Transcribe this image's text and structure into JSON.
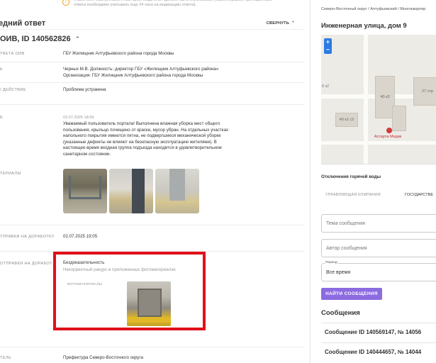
{
  "notice": {
    "icon": "warning-icon",
    "text": "Укажи конечный регламентный срок, когда ответ должен быть опубликован (таким образом, при подготовке ответа необходимо учитывать еще 24 часа на модерацию ответа)."
  },
  "section": {
    "title": "едний ответ",
    "collapse_label": "СВЕРНУТЬ"
  },
  "oiv": {
    "title": "ОИВ, ID 140562826"
  },
  "fields": [
    {
      "label": "ТВЕТА ОИВ",
      "value": "ГБУ Жилищник Алтуфьевского района города Москвы"
    },
    {
      "label": "Ь",
      "value": "Черных М.В. Должность: директор ГБУ «Жилищник Алтуфьевского района» Организация: ГБУ Жилищник Алтуфьевского района города Москвы"
    },
    {
      "label": "/ ДЕЙСТВИЕ",
      "value": "Проблема устранена"
    }
  ],
  "answer": {
    "label": "Б",
    "date": "02.07.2025 18:59",
    "text": "Уважаемый пользователь портала! Выполнена влажная уборка мест общего пользования, крыльцо почищено от краски, мусор убран. На отдельных участках напольного покрытия имеются пятна, не подвергшиеся механической уборке (указанные дефекты не влияют на безопасную эксплуатацию жителями). В настоящее время входная группа подъезда находится в удовлетворительном санитарном состоянии."
  },
  "materials_label": "ТЕРИАЛЫ",
  "rework_sent": {
    "label": "ТПРАВКИ НА ДОРАБОТКУ",
    "value": "02.07.2025 19:05"
  },
  "rework_reason": {
    "label": "ОТПРАВКИ НА ДОРАБОТ",
    "title": "Бездоказательность",
    "detail": "Некорректный ракурс в приложенных фотоматериалах",
    "photos_label": "ФОТОМАТЕРИАЛЫ"
  },
  "bottom_field": {
    "label": "ТЕЛЬ",
    "value": "Префектура Северо-Восточного округа"
  },
  "right": {
    "breadcrumb": "Северо-Восточный округ / Алтуфьевский / Многоквартир",
    "address": "Инженерная улица, дом 9",
    "map": {
      "zoom_in": "+",
      "zoom_out": "−",
      "labels": [
        "40 к3",
        "27 стр",
        "8 к2",
        "40 к1 с2"
      ],
      "poi": "Астарта Медик"
    },
    "topic": "Отключения горячей воды",
    "company_label": "УПРАВЛЯЮЩАЯ КОМПАНИЯ",
    "company_value": "ГОСУДАРСТВЕ",
    "topic_placeholder": "Тема сообщения",
    "author_placeholder": "Автор сообщения",
    "period_label": "Период",
    "period_value": "Все время",
    "find_button": "НАЙТИ СООБЩЕНИЯ",
    "messages_title": "Сообщения",
    "messages": [
      "Сообщение ID 140569147, № 14056",
      "Сообщение ID 140444657, № 14044"
    ]
  }
}
